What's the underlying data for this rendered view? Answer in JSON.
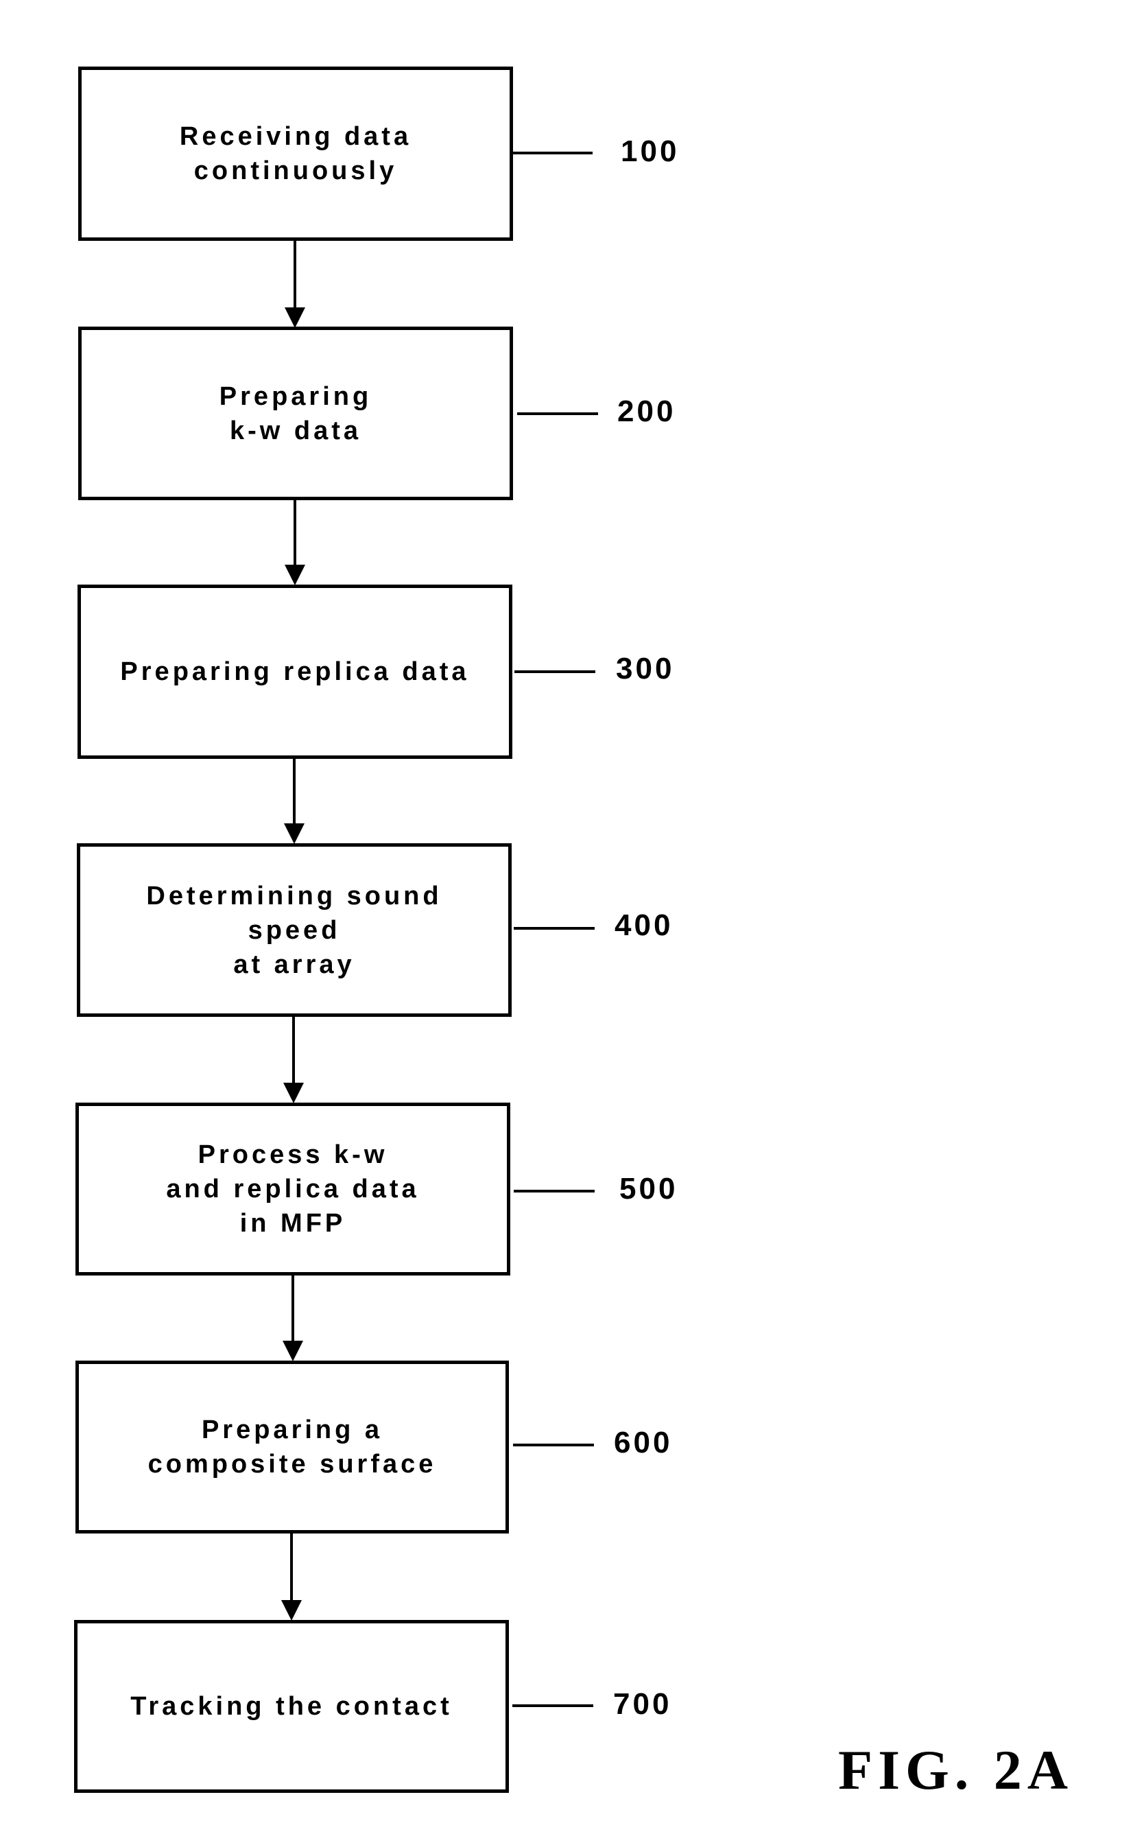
{
  "figure": {
    "label": "FIG. 2A",
    "type": "flowchart",
    "steps": [
      {
        "text": "Receiving data\ncontinuously",
        "ref": "100"
      },
      {
        "text": "Preparing\nk-w data",
        "ref": "200"
      },
      {
        "text": "Preparing replica data",
        "ref": "300"
      },
      {
        "text": "Determining sound\nspeed\nat array",
        "ref": "400"
      },
      {
        "text": "Process k-w\nand replica data\nin MFP",
        "ref": "500"
      },
      {
        "text": "Preparing a\ncomposite surface",
        "ref": "600"
      },
      {
        "text": "Tracking the contact",
        "ref": "700"
      }
    ],
    "connections": [
      {
        "from": "100",
        "to": "200"
      },
      {
        "from": "200",
        "to": "300"
      },
      {
        "from": "300",
        "to": "400"
      },
      {
        "from": "400",
        "to": "500"
      },
      {
        "from": "500",
        "to": "600"
      },
      {
        "from": "600",
        "to": "700"
      }
    ]
  }
}
